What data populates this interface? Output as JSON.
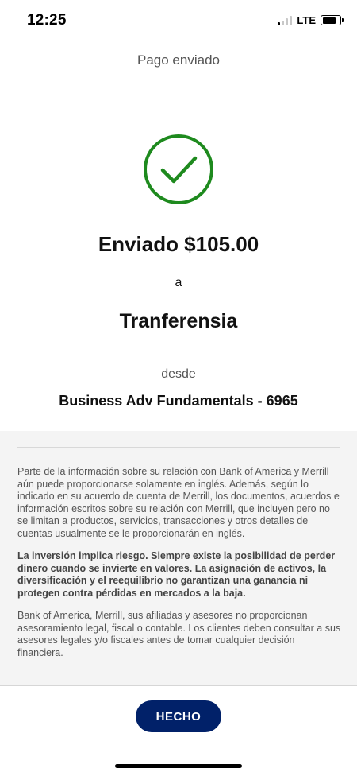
{
  "status_bar": {
    "time": "12:25",
    "network": "LTE",
    "signal_bars": 4,
    "signal_bars_active": 1
  },
  "header": {
    "title": "Pago enviado"
  },
  "confirmation": {
    "icon": "check-circle-icon",
    "success_color": "#1e8a1e",
    "amount_text": "Enviado $105.00",
    "to_word": "a",
    "recipient": "Tranferensia",
    "from_word": "desde",
    "account": "Business Adv Fundamentals - 6965"
  },
  "disclosures": {
    "paragraph_1": "Parte de la información sobre su relación con Bank of America y Merrill aún puede proporcionarse solamente en inglés. Además, según lo indicado en su acuerdo de cuenta de Merrill, los documentos, acuerdos e información escritos sobre su relación con Merrill, que incluyen pero no se limitan a productos, servicios, transacciones y otros detalles de cuentas usualmente se le proporcionarán en inglés.",
    "paragraph_2": "La inversión implica riesgo. Siempre existe la posibilidad de perder dinero cuando se invierte en valores. La asignación de activos, la diversificación y el reequilibrio no garantizan una ganancia ni protegen contra pérdidas en mercados a la baja.",
    "paragraph_3": "Bank of America, Merrill, sus afiliadas y asesores no proporcionan asesoramiento legal, fiscal o contable. Los clientes deben consultar a sus asesores legales y/o fiscales antes de tomar cualquier decisión financiera."
  },
  "footer": {
    "done_label": "HECHO",
    "button_color": "#012169"
  }
}
